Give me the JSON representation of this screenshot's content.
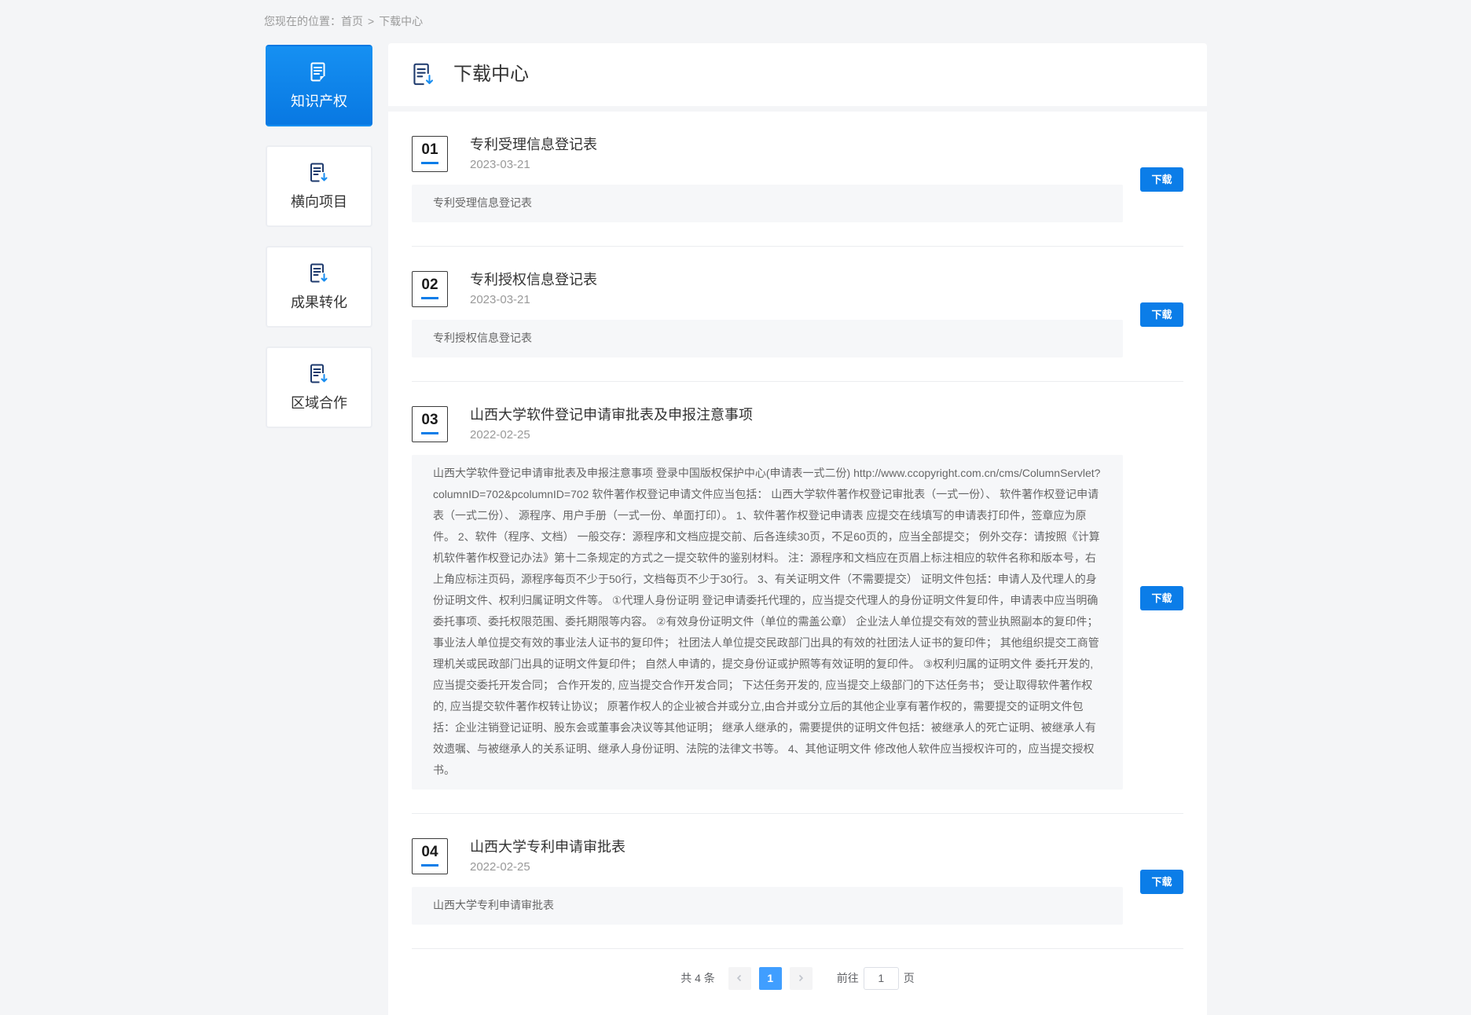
{
  "breadcrumb": {
    "prefix": "您现在的位置：",
    "home": "首页",
    "separator": ">",
    "current": "下载中心"
  },
  "sidebar": {
    "items": [
      {
        "label": "知识产权",
        "icon": "document-icon",
        "active": true
      },
      {
        "label": "横向项目",
        "icon": "document-download-icon",
        "active": false
      },
      {
        "label": "成果转化",
        "icon": "document-download-icon",
        "active": false
      },
      {
        "label": "区域合作",
        "icon": "document-download-icon",
        "active": false
      }
    ]
  },
  "header": {
    "title": "下载中心",
    "icon": "document-download-icon"
  },
  "downloads": [
    {
      "number": "01",
      "title": "专利受理信息登记表",
      "date": "2023-03-21",
      "description": "专利受理信息登记表",
      "button_label": "下载"
    },
    {
      "number": "02",
      "title": "专利授权信息登记表",
      "date": "2023-03-21",
      "description": "专利授权信息登记表",
      "button_label": "下载"
    },
    {
      "number": "03",
      "title": "山西大学软件登记申请审批表及申报注意事项",
      "date": "2022-02-25",
      "description": "山西大学软件登记申请审批表及申报注意事项 登录中国版权保护中心(申请表一式二份) http://www.ccopyright.com.cn/cms/ColumnServlet?columnID=702&pcolumnID=702 软件著作权登记申请文件应当包括： 山西大学软件著作权登记审批表（一式一份）、 软件著作权登记申请表（一式二份）、 源程序、用户手册（一式一份、单面打印）。 1、软件著作权登记申请表 应提交在线填写的申请表打印件，签章应为原件。 2、软件（程序、文档） 一般交存：源程序和文档应提交前、后各连续30页，不足60页的，应当全部提交； 例外交存：请按照《计算机软件著作权登记办法》第十二条规定的方式之一提交软件的鉴别材料。 注：源程序和文档应在页眉上标注相应的软件名称和版本号，右上角应标注页码，源程序每页不少于50行，文档每页不少于30行。 3、有关证明文件（不需要提交） 证明文件包括：申请人及代理人的身份证明文件、权利归属证明文件等。 ①代理人身份证明 登记申请委托代理的，应当提交代理人的身份证明文件复印件，申请表中应当明确委托事项、委托权限范围、委托期限等内容。 ②有效身份证明文件（单位的需盖公章） 企业法人单位提交有效的营业执照副本的复印件； 事业法人单位提交有效的事业法人证书的复印件； 社团法人单位提交民政部门出具的有效的社团法人证书的复印件； 其他组织提交工商管理机关或民政部门出具的证明文件复印件； 自然人申请的，提交身份证或护照等有效证明的复印件。 ③权利归属的证明文件 委托开发的,应当提交委托开发合同； 合作开发的, 应当提交合作开发合同； 下达任务开发的, 应当提交上级部门的下达任务书； 受让取得软件著作权的, 应当提交软件著作权转让协议； 原著作权人的企业被合并或分立,由合并或分立后的其他企业享有著作权的，需要提交的证明文件包括：企业注销登记证明、股东会或董事会决议等其他证明； 继承人继承的，需要提供的证明文件包括：被继承人的死亡证明、被继承人有效遗嘱、与被继承人的关系证明、继承人身份证明、法院的法律文书等。 4、其他证明文件 修改他人软件应当授权许可的，应当提交授权书。",
      "button_label": "下载"
    },
    {
      "number": "04",
      "title": "山西大学专利申请审批表",
      "date": "2022-02-25",
      "description": "山西大学专利申请审批表",
      "button_label": "下载"
    }
  ],
  "pagination": {
    "total_text": "共 4 条",
    "current_page": "1",
    "goto_prefix": "前往",
    "goto_value": "1",
    "goto_suffix": "页",
    "prev_icon": "chevron-left-icon",
    "next_icon": "chevron-right-icon"
  },
  "colors": {
    "accent": "#0b7de8",
    "page_active": "#409eff",
    "page_bg": "#f4f5f7",
    "text_primary": "#333333",
    "text_muted": "#999999"
  }
}
